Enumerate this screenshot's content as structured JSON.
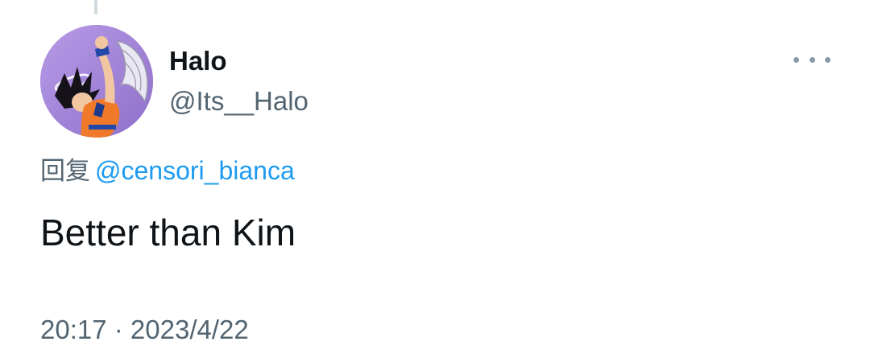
{
  "tweet": {
    "author": {
      "display_name": "Halo",
      "handle": "@Its__Halo",
      "avatar_icon": "avatar-cartoon-character"
    },
    "reply": {
      "prefix": "回复",
      "mention": "@censori_bianca"
    },
    "text": "Better than Kim",
    "timestamp": "20:17 · 2023/4/22",
    "more_icon": "more-horizontal-icon"
  },
  "colors": {
    "text_primary": "#0f1419",
    "text_secondary": "#536471",
    "link": "#1d9bf0",
    "avatar_bg": "#a98bd6"
  }
}
